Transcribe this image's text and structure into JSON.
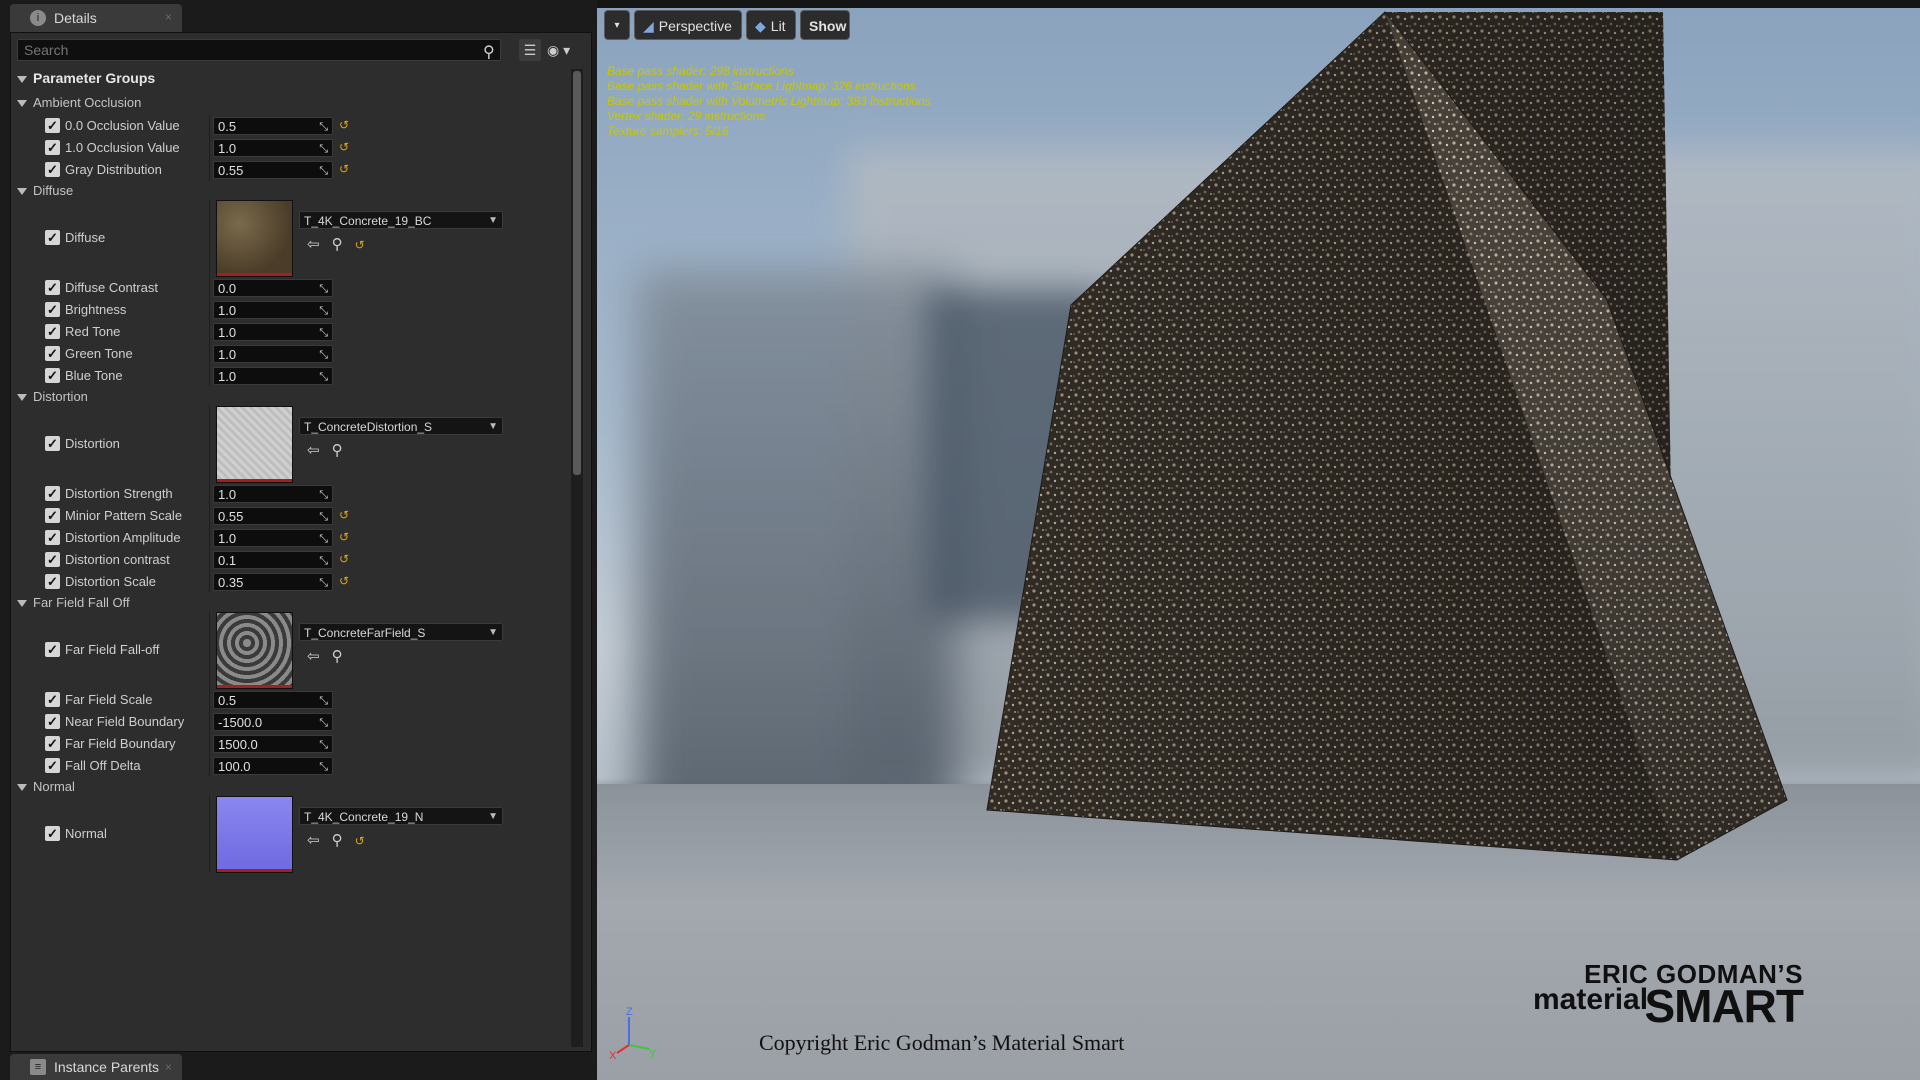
{
  "details": {
    "tab_title": "Details",
    "tab_close": "×",
    "search_placeholder": "Search",
    "group_header": "Parameter Groups",
    "categories": [
      "Ambient Occlusion",
      "Diffuse",
      "Distortion",
      "Far Field Fall Off",
      "Normal"
    ],
    "params": [
      {
        "name": "0.0 Occlusion Value",
        "value": "0.5",
        "reset": true
      },
      {
        "name": "1.0 Occlusion Value",
        "value": "1.0",
        "reset": true
      },
      {
        "name": "Gray Distribution",
        "value": "0.55",
        "reset": true
      },
      {
        "name": "Diffuse",
        "texture": "T_4K_Concrete_19_BC",
        "reset": true
      },
      {
        "name": "Diffuse Contrast",
        "value": "0.0",
        "reset": false
      },
      {
        "name": "Brightness",
        "value": "1.0",
        "reset": false
      },
      {
        "name": "Red Tone",
        "value": "1.0",
        "reset": false
      },
      {
        "name": "Green Tone",
        "value": "1.0",
        "reset": false
      },
      {
        "name": "Blue Tone",
        "value": "1.0",
        "reset": false
      },
      {
        "name": "Distortion",
        "texture": "T_ConcreteDistortion_S",
        "reset": false
      },
      {
        "name": "Distortion Strength",
        "value": "1.0",
        "reset": false
      },
      {
        "name": "Minior Pattern Scale",
        "value": "0.55",
        "reset": true
      },
      {
        "name": "Distortion Amplitude",
        "value": "1.0",
        "reset": true
      },
      {
        "name": "Distortion contrast",
        "value": "0.1",
        "reset": true
      },
      {
        "name": "Distortion Scale",
        "value": "0.35",
        "reset": true
      },
      {
        "name": "Far Field Fall-off",
        "texture": "T_ConcreteFarField_S",
        "reset": false
      },
      {
        "name": "Far Field Scale",
        "value": "0.5",
        "reset": false
      },
      {
        "name": "Near Field Boundary",
        "value": "-1500.0",
        "reset": false
      },
      {
        "name": "Far Field Boundary",
        "value": "1500.0",
        "reset": false
      },
      {
        "name": "Fall Off Delta",
        "value": "100.0",
        "reset": false
      },
      {
        "name": "Normal",
        "texture": "T_4K_Concrete_19_N",
        "reset": true
      }
    ],
    "bottom_tab": "Instance Parents"
  },
  "viewport": {
    "menu_label": "▾",
    "perspective_label": "Perspective",
    "lit_label": "Lit",
    "show_label": "Show",
    "stats": [
      "Base pass shader: 298 instructions",
      "Base pass shader with Surface Lightmap: 326 instructions",
      "Base pass shader with Volumetric Lightmap: 383 instructions",
      "Vertex shader: 29 instructions",
      "Texture samplers: 5/16"
    ],
    "axis_labels": {
      "x": "X",
      "y": "Y",
      "z": "Z"
    },
    "copyright": "Copyright Eric Godman’s Material Smart",
    "brand_line1": "ERIC GODMAN’S",
    "brand_line2": "material",
    "brand_line3": "SMART"
  },
  "colors": {
    "panel_bg": "#2d2d2d",
    "reset_arrow": "#d9a617",
    "stats_text": "#c8c800",
    "thumb_redline": "#a32020"
  }
}
